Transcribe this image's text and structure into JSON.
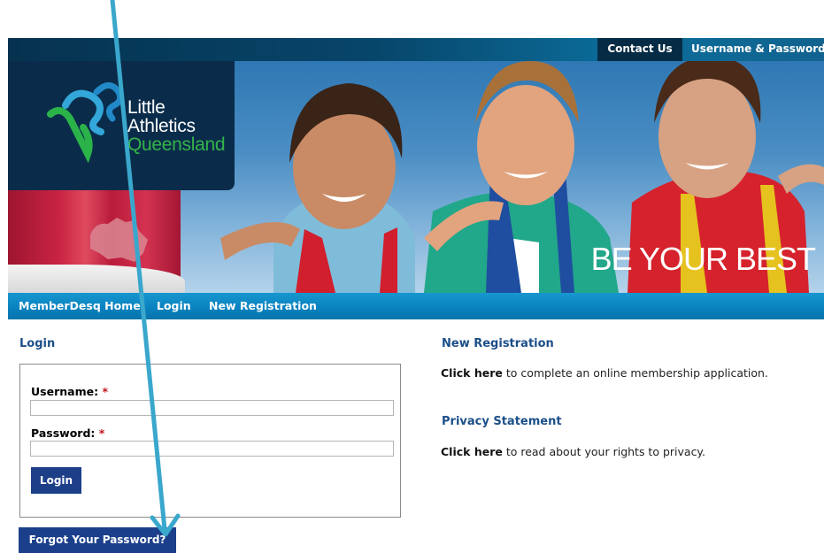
{
  "topbar": {
    "contact_label": "Contact Us",
    "userpass_label": "Username & Password"
  },
  "banner": {
    "logo": {
      "line1": "Little",
      "line2": "Athletics",
      "line3": "Queensland"
    },
    "tagline": "BE YOUR BEST",
    "colors": {
      "logo_bg": "#0a2c4a",
      "logo_green": "#34b44a",
      "flag_maroon": "#b91b3a"
    }
  },
  "nav": {
    "items": [
      {
        "label": "MemberDesq Home"
      },
      {
        "label": "Login"
      },
      {
        "label": "New Registration"
      }
    ]
  },
  "login": {
    "title": "Login",
    "username_label": "Username:",
    "password_label": "Password:",
    "required_mark": "*",
    "username_value": "",
    "password_value": "",
    "button_label": "Login",
    "forgot_label": "Forgot Your Password?"
  },
  "registration": {
    "title": "New Registration",
    "link_text": "Click here",
    "text": " to complete an online membership application."
  },
  "privacy": {
    "title": "Privacy Statement",
    "link_text": "Click here",
    "text": " to read about your rights to privacy."
  },
  "colors": {
    "nav_blue": "#0a83c0",
    "button_navy": "#1c3f88",
    "heading_blue": "#1b4f88",
    "arrow_cyan": "#3aa7cc"
  }
}
